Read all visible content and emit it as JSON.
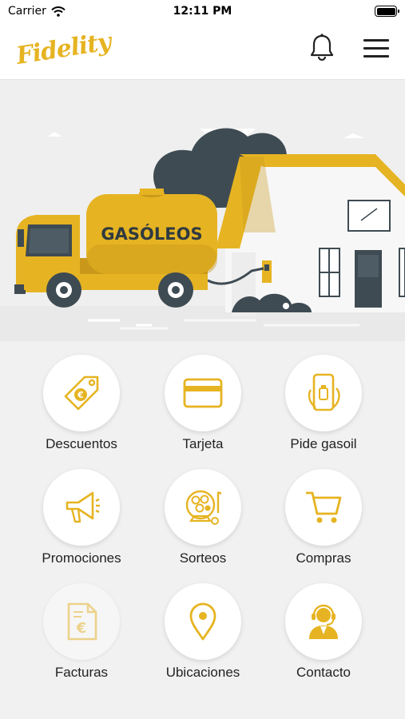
{
  "status_bar": {
    "carrier": "Carrier",
    "time": "12:11 PM"
  },
  "header": {
    "logo_text": "Fidelity"
  },
  "hero": {
    "truck_label": "GASÓLEOS"
  },
  "menu": [
    {
      "label": "Descuentos",
      "icon": "discount-tag-icon"
    },
    {
      "label": "Tarjeta",
      "icon": "card-icon"
    },
    {
      "label": "Pide gasoil",
      "icon": "phone-order-icon"
    },
    {
      "label": "Promociones",
      "icon": "megaphone-icon"
    },
    {
      "label": "Sorteos",
      "icon": "lottery-icon"
    },
    {
      "label": "Compras",
      "icon": "cart-icon"
    },
    {
      "label": "Facturas",
      "icon": "invoice-icon"
    },
    {
      "label": "Ubicaciones",
      "icon": "location-pin-icon"
    },
    {
      "label": "Contacto",
      "icon": "support-agent-icon"
    }
  ],
  "colors": {
    "accent": "#e6b422",
    "dark": "#3d4a52",
    "background": "#f1f1f1"
  }
}
